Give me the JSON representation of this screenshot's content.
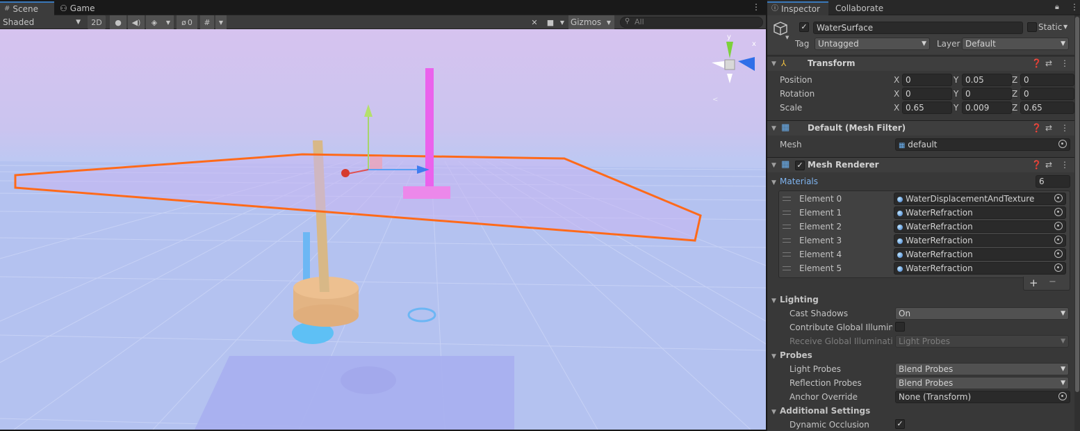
{
  "scene_tabs": {
    "scene": "Scene",
    "game": "Game"
  },
  "scene_toolbar": {
    "shading_mode": "Shaded",
    "mode_2d": "2D",
    "hidden_count": "0",
    "gizmos": "Gizmos",
    "search_placeholder": "All"
  },
  "viewport": {
    "orientation_gizmo": {
      "y_label": "y",
      "x_label": "x"
    }
  },
  "inspector_tabs": {
    "inspector": "Inspector",
    "collaborate": "Collaborate"
  },
  "gameobject": {
    "name": "WaterSurface",
    "active": true,
    "static_label": "Static",
    "tag_label": "Tag",
    "tag_value": "Untagged",
    "layer_label": "Layer",
    "layer_value": "Default"
  },
  "transform": {
    "title": "Transform",
    "rows": [
      {
        "label": "Position",
        "x": "0",
        "y": "0.05",
        "z": "0"
      },
      {
        "label": "Rotation",
        "x": "0",
        "y": "0",
        "z": "0"
      },
      {
        "label": "Scale",
        "x": "0.65",
        "y": "0.009",
        "z": "0.65"
      }
    ],
    "axis_labels": {
      "x": "X",
      "y": "Y",
      "z": "Z"
    }
  },
  "mesh_filter": {
    "title": "Default (Mesh Filter)",
    "mesh_label": "Mesh",
    "mesh_value": "default"
  },
  "mesh_renderer": {
    "title": "Mesh Renderer",
    "enabled": true,
    "materials_label": "Materials",
    "materials_count": "6",
    "elements": [
      {
        "label": "Element 0",
        "value": "WaterDisplacementAndTexture"
      },
      {
        "label": "Element 1",
        "value": "WaterRefraction"
      },
      {
        "label": "Element 2",
        "value": "WaterRefraction"
      },
      {
        "label": "Element 3",
        "value": "WaterRefraction"
      },
      {
        "label": "Element 4",
        "value": "WaterRefraction"
      },
      {
        "label": "Element 5",
        "value": "WaterRefraction"
      }
    ],
    "add_button": "+",
    "remove_button": "−",
    "lighting": {
      "title": "Lighting",
      "cast_shadows_label": "Cast Shadows",
      "cast_shadows_value": "On",
      "contribute_gi_label": "Contribute Global Illuminat",
      "receive_gi_label": "Receive Global Illuminatior",
      "receive_gi_value": "Light Probes"
    },
    "probes": {
      "title": "Probes",
      "light_probes_label": "Light Probes",
      "light_probes_value": "Blend Probes",
      "reflection_probes_label": "Reflection Probes",
      "reflection_probes_value": "Blend Probes",
      "anchor_override_label": "Anchor Override",
      "anchor_override_value": "None (Transform)"
    },
    "additional": {
      "title": "Additional Settings",
      "dynamic_occlusion_label": "Dynamic Occlusion",
      "dynamic_occlusion": true
    }
  },
  "colors": {
    "selection_outline": "#ff6a1a",
    "accent_blue": "#3a79bb",
    "panel_bg": "#383838"
  }
}
